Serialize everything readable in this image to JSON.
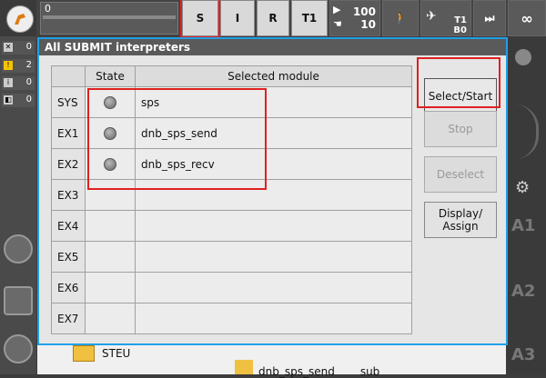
{
  "topbar": {
    "message_count": "0",
    "buttons": {
      "s": "S",
      "i": "I",
      "r": "R",
      "t1": "T1",
      "override_run": "100",
      "override_jog": "10",
      "tool_t": "T1",
      "tool_b": "B0",
      "infinity": "∞"
    }
  },
  "messages": {
    "ack": "0",
    "warn": "2",
    "info": "0",
    "wait": "0"
  },
  "dialog": {
    "title": "All SUBMIT interpreters",
    "columns": [
      "",
      "State",
      "Selected module"
    ],
    "rows": [
      {
        "id": "SYS",
        "module": "sps",
        "has_state": true
      },
      {
        "id": "EX1",
        "module": "dnb_sps_send",
        "has_state": true
      },
      {
        "id": "EX2",
        "module": "dnb_sps_recv",
        "has_state": true
      },
      {
        "id": "EX3",
        "module": "",
        "has_state": false
      },
      {
        "id": "EX4",
        "module": "",
        "has_state": false
      },
      {
        "id": "EX5",
        "module": "",
        "has_state": false
      },
      {
        "id": "EX6",
        "module": "",
        "has_state": false
      },
      {
        "id": "EX7",
        "module": "",
        "has_state": false
      }
    ],
    "buttons": {
      "select_start": "Select/Start",
      "stop": "Stop",
      "deselect": "Deselect",
      "display_assign_1": "Display/",
      "display_assign_2": "Assign"
    }
  },
  "background": {
    "folder_label": "STEU",
    "file_label": "dnb_sps_send",
    "file_ext": "sub"
  },
  "axes": [
    "A1",
    "A2",
    "A3"
  ],
  "colors": {
    "accent": "#1fa0e8",
    "highlight": "#e02020"
  }
}
